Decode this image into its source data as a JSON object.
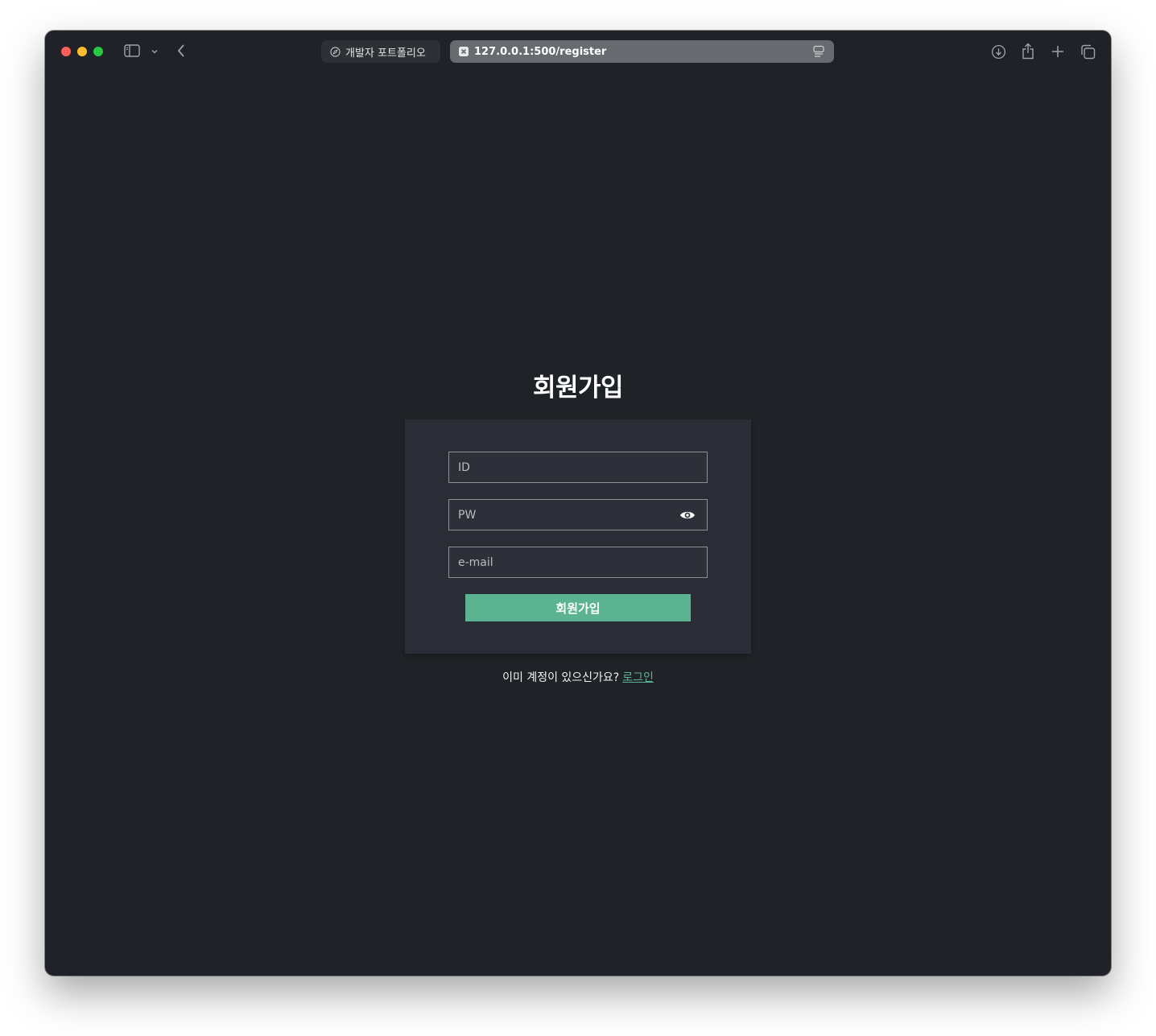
{
  "browser": {
    "tabs": [
      {
        "label": "개발자 포트폴리오",
        "active": false
      },
      {
        "label": "127.0.0.1:500/register",
        "active": true
      }
    ],
    "icons": {
      "sidebar": "sidebar-icon",
      "chevron": "chevron-down-icon",
      "back": "back-icon",
      "download": "download-icon",
      "share": "share-icon",
      "new_tab": "plus-icon",
      "tabs_overview": "tabs-overview-icon"
    }
  },
  "page": {
    "title": "회원가입",
    "fields": {
      "id_placeholder": "ID",
      "pw_placeholder": "PW",
      "email_placeholder": "e-mail"
    },
    "submit_label": "회원가입",
    "footer_prompt": "이미 계정이 있으신가요?",
    "login_link": "로그인",
    "colors": {
      "accent": "#5cb391",
      "background": "#1f2226",
      "card": "#2a2d35"
    }
  }
}
